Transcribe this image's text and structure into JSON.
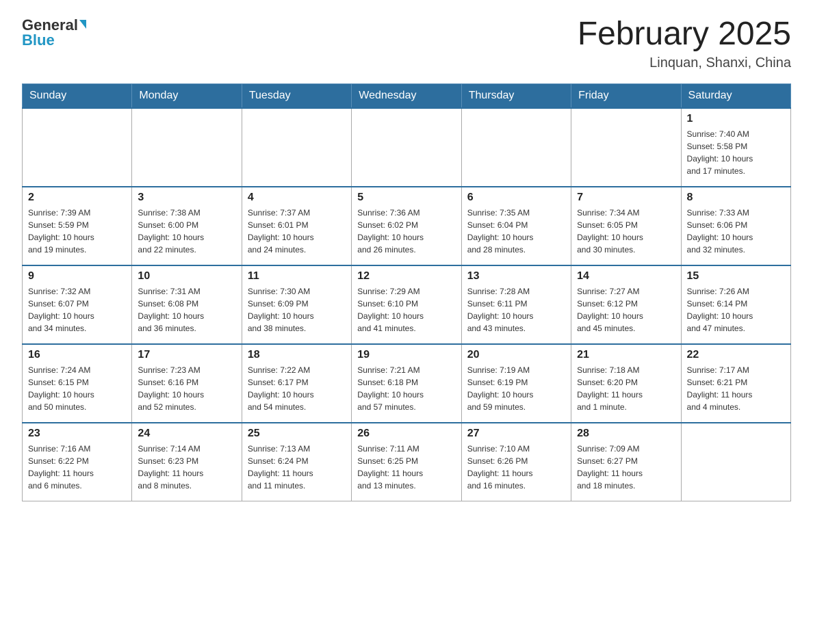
{
  "header": {
    "logo_general": "General",
    "logo_blue": "Blue",
    "month_title": "February 2025",
    "location": "Linquan, Shanxi, China"
  },
  "weekdays": [
    "Sunday",
    "Monday",
    "Tuesday",
    "Wednesday",
    "Thursday",
    "Friday",
    "Saturday"
  ],
  "weeks": [
    [
      {
        "day": "",
        "info": ""
      },
      {
        "day": "",
        "info": ""
      },
      {
        "day": "",
        "info": ""
      },
      {
        "day": "",
        "info": ""
      },
      {
        "day": "",
        "info": ""
      },
      {
        "day": "",
        "info": ""
      },
      {
        "day": "1",
        "info": "Sunrise: 7:40 AM\nSunset: 5:58 PM\nDaylight: 10 hours\nand 17 minutes."
      }
    ],
    [
      {
        "day": "2",
        "info": "Sunrise: 7:39 AM\nSunset: 5:59 PM\nDaylight: 10 hours\nand 19 minutes."
      },
      {
        "day": "3",
        "info": "Sunrise: 7:38 AM\nSunset: 6:00 PM\nDaylight: 10 hours\nand 22 minutes."
      },
      {
        "day": "4",
        "info": "Sunrise: 7:37 AM\nSunset: 6:01 PM\nDaylight: 10 hours\nand 24 minutes."
      },
      {
        "day": "5",
        "info": "Sunrise: 7:36 AM\nSunset: 6:02 PM\nDaylight: 10 hours\nand 26 minutes."
      },
      {
        "day": "6",
        "info": "Sunrise: 7:35 AM\nSunset: 6:04 PM\nDaylight: 10 hours\nand 28 minutes."
      },
      {
        "day": "7",
        "info": "Sunrise: 7:34 AM\nSunset: 6:05 PM\nDaylight: 10 hours\nand 30 minutes."
      },
      {
        "day": "8",
        "info": "Sunrise: 7:33 AM\nSunset: 6:06 PM\nDaylight: 10 hours\nand 32 minutes."
      }
    ],
    [
      {
        "day": "9",
        "info": "Sunrise: 7:32 AM\nSunset: 6:07 PM\nDaylight: 10 hours\nand 34 minutes."
      },
      {
        "day": "10",
        "info": "Sunrise: 7:31 AM\nSunset: 6:08 PM\nDaylight: 10 hours\nand 36 minutes."
      },
      {
        "day": "11",
        "info": "Sunrise: 7:30 AM\nSunset: 6:09 PM\nDaylight: 10 hours\nand 38 minutes."
      },
      {
        "day": "12",
        "info": "Sunrise: 7:29 AM\nSunset: 6:10 PM\nDaylight: 10 hours\nand 41 minutes."
      },
      {
        "day": "13",
        "info": "Sunrise: 7:28 AM\nSunset: 6:11 PM\nDaylight: 10 hours\nand 43 minutes."
      },
      {
        "day": "14",
        "info": "Sunrise: 7:27 AM\nSunset: 6:12 PM\nDaylight: 10 hours\nand 45 minutes."
      },
      {
        "day": "15",
        "info": "Sunrise: 7:26 AM\nSunset: 6:14 PM\nDaylight: 10 hours\nand 47 minutes."
      }
    ],
    [
      {
        "day": "16",
        "info": "Sunrise: 7:24 AM\nSunset: 6:15 PM\nDaylight: 10 hours\nand 50 minutes."
      },
      {
        "day": "17",
        "info": "Sunrise: 7:23 AM\nSunset: 6:16 PM\nDaylight: 10 hours\nand 52 minutes."
      },
      {
        "day": "18",
        "info": "Sunrise: 7:22 AM\nSunset: 6:17 PM\nDaylight: 10 hours\nand 54 minutes."
      },
      {
        "day": "19",
        "info": "Sunrise: 7:21 AM\nSunset: 6:18 PM\nDaylight: 10 hours\nand 57 minutes."
      },
      {
        "day": "20",
        "info": "Sunrise: 7:19 AM\nSunset: 6:19 PM\nDaylight: 10 hours\nand 59 minutes."
      },
      {
        "day": "21",
        "info": "Sunrise: 7:18 AM\nSunset: 6:20 PM\nDaylight: 11 hours\nand 1 minute."
      },
      {
        "day": "22",
        "info": "Sunrise: 7:17 AM\nSunset: 6:21 PM\nDaylight: 11 hours\nand 4 minutes."
      }
    ],
    [
      {
        "day": "23",
        "info": "Sunrise: 7:16 AM\nSunset: 6:22 PM\nDaylight: 11 hours\nand 6 minutes."
      },
      {
        "day": "24",
        "info": "Sunrise: 7:14 AM\nSunset: 6:23 PM\nDaylight: 11 hours\nand 8 minutes."
      },
      {
        "day": "25",
        "info": "Sunrise: 7:13 AM\nSunset: 6:24 PM\nDaylight: 11 hours\nand 11 minutes."
      },
      {
        "day": "26",
        "info": "Sunrise: 7:11 AM\nSunset: 6:25 PM\nDaylight: 11 hours\nand 13 minutes."
      },
      {
        "day": "27",
        "info": "Sunrise: 7:10 AM\nSunset: 6:26 PM\nDaylight: 11 hours\nand 16 minutes."
      },
      {
        "day": "28",
        "info": "Sunrise: 7:09 AM\nSunset: 6:27 PM\nDaylight: 11 hours\nand 18 minutes."
      },
      {
        "day": "",
        "info": ""
      }
    ]
  ]
}
